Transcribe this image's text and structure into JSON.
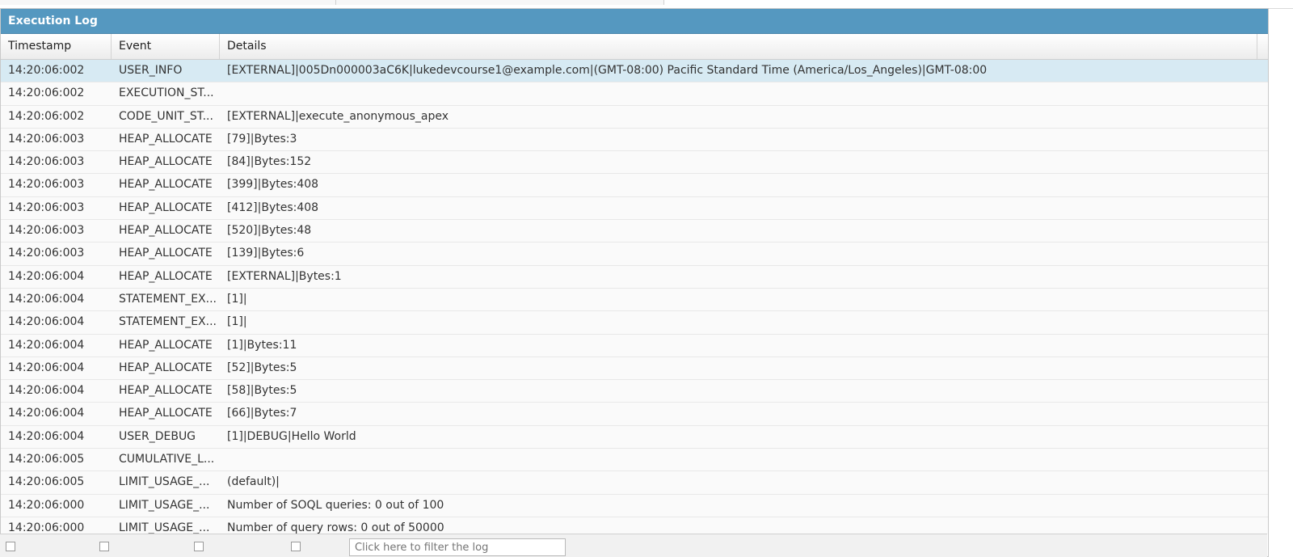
{
  "panel": {
    "title": "Execution Log"
  },
  "columns": {
    "timestamp": "Timestamp",
    "event": "Event",
    "details": "Details"
  },
  "rows": [
    {
      "timestamp": "14:20:06:002",
      "event": "USER_INFO",
      "details": "[EXTERNAL]|005Dn000003aC6K|lukedevcourse1@example.com|(GMT-08:00) Pacific Standard Time (America/Los_Angeles)|GMT-08:00"
    },
    {
      "timestamp": "14:20:06:002",
      "event": "EXECUTION_ST...",
      "details": ""
    },
    {
      "timestamp": "14:20:06:002",
      "event": "CODE_UNIT_ST...",
      "details": "[EXTERNAL]|execute_anonymous_apex"
    },
    {
      "timestamp": "14:20:06:003",
      "event": "HEAP_ALLOCATE",
      "details": "[79]|Bytes:3"
    },
    {
      "timestamp": "14:20:06:003",
      "event": "HEAP_ALLOCATE",
      "details": "[84]|Bytes:152"
    },
    {
      "timestamp": "14:20:06:003",
      "event": "HEAP_ALLOCATE",
      "details": "[399]|Bytes:408"
    },
    {
      "timestamp": "14:20:06:003",
      "event": "HEAP_ALLOCATE",
      "details": "[412]|Bytes:408"
    },
    {
      "timestamp": "14:20:06:003",
      "event": "HEAP_ALLOCATE",
      "details": "[520]|Bytes:48"
    },
    {
      "timestamp": "14:20:06:003",
      "event": "HEAP_ALLOCATE",
      "details": "[139]|Bytes:6"
    },
    {
      "timestamp": "14:20:06:004",
      "event": "HEAP_ALLOCATE",
      "details": "[EXTERNAL]|Bytes:1"
    },
    {
      "timestamp": "14:20:06:004",
      "event": "STATEMENT_EX...",
      "details": "[1]|"
    },
    {
      "timestamp": "14:20:06:004",
      "event": "STATEMENT_EX...",
      "details": "[1]|"
    },
    {
      "timestamp": "14:20:06:004",
      "event": "HEAP_ALLOCATE",
      "details": "[1]|Bytes:11"
    },
    {
      "timestamp": "14:20:06:004",
      "event": "HEAP_ALLOCATE",
      "details": "[52]|Bytes:5"
    },
    {
      "timestamp": "14:20:06:004",
      "event": "HEAP_ALLOCATE",
      "details": "[58]|Bytes:5"
    },
    {
      "timestamp": "14:20:06:004",
      "event": "HEAP_ALLOCATE",
      "details": "[66]|Bytes:7"
    },
    {
      "timestamp": "14:20:06:004",
      "event": "USER_DEBUG",
      "details": "[1]|DEBUG|Hello World"
    },
    {
      "timestamp": "14:20:06:005",
      "event": "CUMULATIVE_L...",
      "details": ""
    },
    {
      "timestamp": "14:20:06:005",
      "event": "LIMIT_USAGE_...",
      "details": "(default)|"
    },
    {
      "timestamp": "14:20:06:000",
      "event": "LIMIT_USAGE_...",
      "details": "Number of SOQL queries: 0 out of 100"
    },
    {
      "timestamp": "14:20:06:000",
      "event": "LIMIT_USAGE_...",
      "details": "Number of query rows: 0 out of 50000"
    }
  ],
  "selected_row": 0,
  "footer": {
    "filter_placeholder": "Click here to filter the log"
  },
  "colors": {
    "header_bg": "#5598c0",
    "selected_row": "#d7eaf3"
  }
}
